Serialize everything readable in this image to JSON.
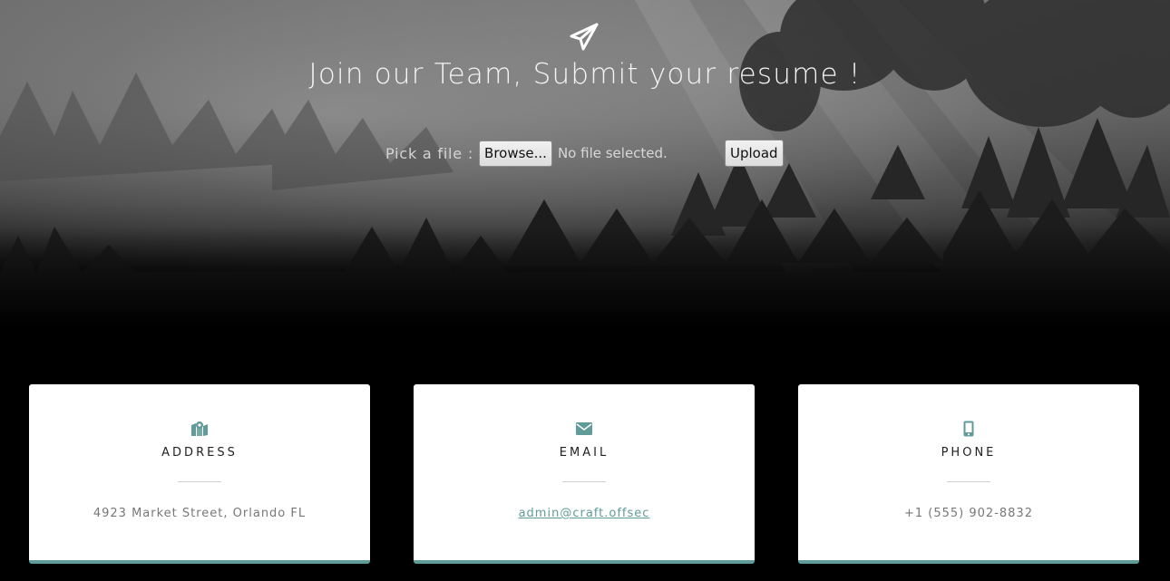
{
  "hero": {
    "title": "Join our Team, Submit your resume !",
    "pick_label": "Pick a file :",
    "browse_label": "Browse...",
    "no_file_text": "No file selected.",
    "upload_label": "Upload",
    "icon": "paper-plane-icon"
  },
  "contact": {
    "accent_color": "#5f9b98",
    "cards": [
      {
        "title": "ADDRESS",
        "value": "4923 Market Street, Orlando FL",
        "icon": "map-icon"
      },
      {
        "title": "EMAIL",
        "value": "admin@craft.offsec",
        "icon": "envelope-icon"
      },
      {
        "title": "PHONE",
        "value": "+1 (555) 902-8832",
        "icon": "mobile-phone-icon"
      }
    ]
  }
}
